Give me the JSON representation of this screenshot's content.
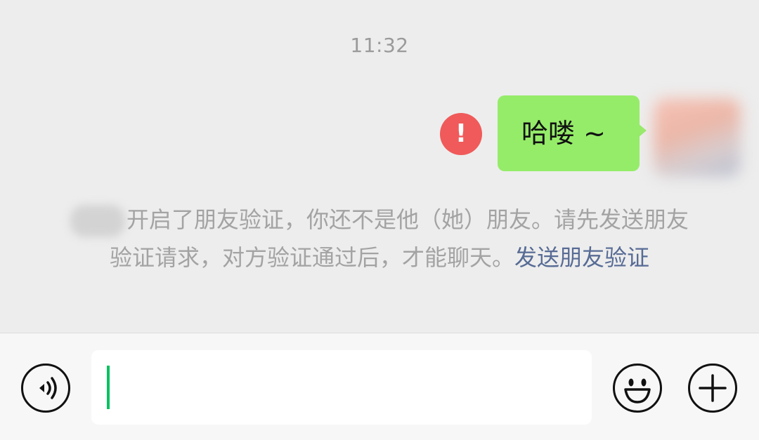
{
  "chat": {
    "timestamp": "11:32",
    "message": {
      "text": "哈喽 ~",
      "status_icon": "exclamation-icon",
      "bubble_color": "#95ec69",
      "error_color": "#f05a5a"
    },
    "system_notice": {
      "text": "开启了朋友验证，你还不是他（她）朋友。请先发送朋友验证请求，对方验证通过后，才能聊天。",
      "link_text": "发送朋友验证",
      "link_color": "#576b95"
    }
  },
  "input_bar": {
    "voice_icon": "voice-icon",
    "emoji_icon": "emoji-icon",
    "plus_icon": "plus-icon",
    "caret_color": "#07c160"
  }
}
